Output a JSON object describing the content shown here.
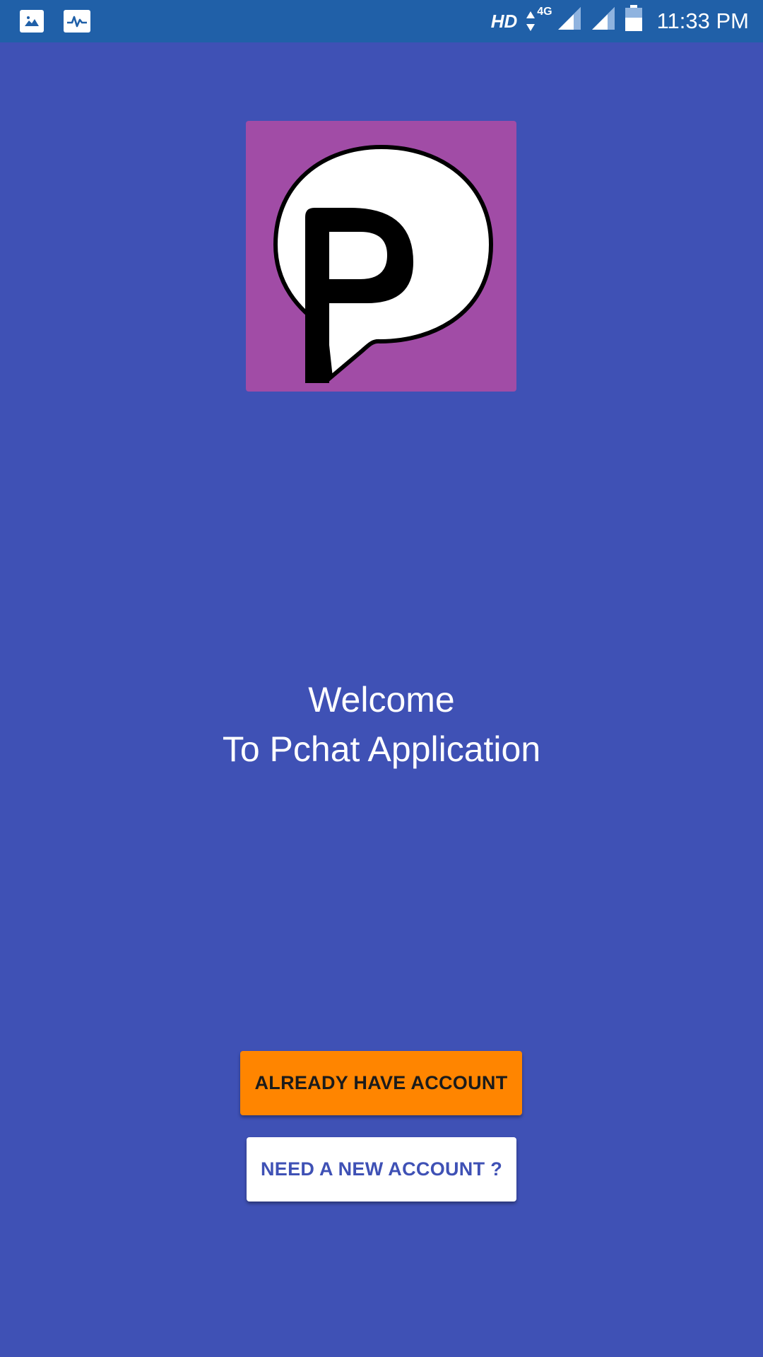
{
  "status_bar": {
    "left_icons": [
      "gallery-icon",
      "activity-icon"
    ],
    "hd_label": "HD",
    "network_label": "4G",
    "time": "11:33 PM"
  },
  "logo": {
    "letter": "P",
    "icon": "chat-bubble-icon",
    "background": "#A14CA6"
  },
  "welcome": {
    "line1": "Welcome",
    "line2": "To Pchat Application"
  },
  "buttons": {
    "login_label": "ALREADY HAVE ACCOUNT",
    "register_label": "NEED A NEW ACCOUNT ?"
  },
  "colors": {
    "background": "#3F51B5",
    "status_bar": "#2060A8",
    "login_button": "#FF8500",
    "register_button": "#FFFFFF"
  }
}
